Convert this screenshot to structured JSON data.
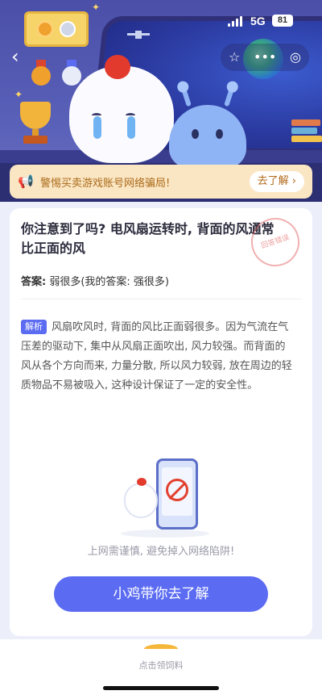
{
  "status_bar": {
    "network": "5G",
    "battery": "81"
  },
  "hero": {
    "icons": [
      "back-icon",
      "medal-frame",
      "trophy-icon",
      "star-icon",
      "more-icon",
      "target-icon"
    ],
    "top_actions": {
      "star": "☆",
      "more": "•••",
      "record": "◎"
    }
  },
  "notice": {
    "icon": "megaphone-icon",
    "text": "警惕买卖游戏账号网络骗局!",
    "button": "去了解 ›"
  },
  "question": {
    "title": "你注意到了吗? 电风扇运转时, 背面的风通常比正面的风",
    "answer_label": "答案:",
    "answer_value": "弱很多(我的答案: 强很多)",
    "stamp": "回答错误"
  },
  "explanation": {
    "tag": "解析",
    "text": "风扇吹风时, 背面的风比正面弱很多。因为气流在气压差的驱动下, 集中从风扇正面吹出, 风力较强。而背面的风从各个方向而来, 力量分散, 所以风力较弱, 放在周边的轻质物品不易被吸入, 这种设计保证了一定的安全性。"
  },
  "promo": {
    "warning": "上网需谨慎, 避免掉入网络陷阱!",
    "cta": "小鸡带你去了解"
  },
  "bottom_bar": {
    "label": "点击领饲料"
  },
  "colors": {
    "hero_bg": "#4b4fa8",
    "notice_bg": "#fbe6c4",
    "accent": "#5b6cf2",
    "tag_bg": "#5b6cf2",
    "feed_icon": "#f5b73a"
  }
}
